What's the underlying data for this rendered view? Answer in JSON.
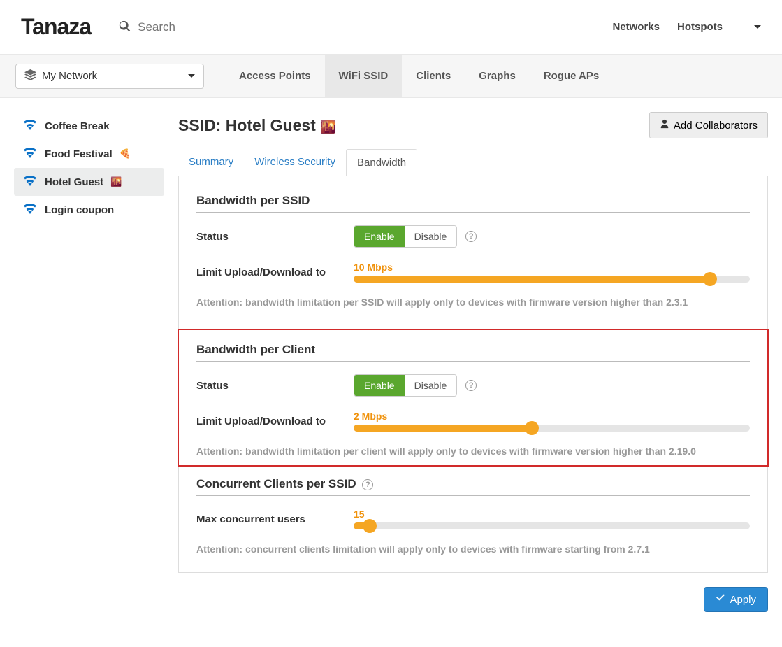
{
  "header": {
    "logo": "Tanaza",
    "search_placeholder": "Search",
    "nav": {
      "networks": "Networks",
      "hotspots": "Hotspots"
    }
  },
  "subnav": {
    "network_selected": "My Network",
    "tabs": {
      "access_points": "Access Points",
      "wifi_ssid": "WiFi SSID",
      "clients": "Clients",
      "graphs": "Graphs",
      "rogue_aps": "Rogue APs"
    }
  },
  "sidebar": {
    "items": [
      {
        "label": "Coffee Break",
        "emoji": ""
      },
      {
        "label": "Food Festival",
        "emoji": "🍕"
      },
      {
        "label": "Hotel Guest",
        "emoji": "🌇"
      },
      {
        "label": "Login coupon",
        "emoji": ""
      }
    ]
  },
  "content": {
    "title_prefix": "SSID: ",
    "title_name": "Hotel Guest",
    "title_emoji": "🌇",
    "collab_button": "Add Collaborators",
    "inner_tabs": {
      "summary": "Summary",
      "wireless_security": "Wireless Security",
      "bandwidth": "Bandwidth"
    },
    "sections": {
      "bw_ssid": {
        "title": "Bandwidth per SSID",
        "status_label": "Status",
        "enable": "Enable",
        "disable": "Disable",
        "limit_label": "Limit Upload/Download to",
        "limit_value": "10 Mbps",
        "slider_percent": 90,
        "attention": "Attention: bandwidth limitation per SSID will apply only to devices with firmware version higher than 2.3.1"
      },
      "bw_client": {
        "title": "Bandwidth per Client",
        "status_label": "Status",
        "enable": "Enable",
        "disable": "Disable",
        "limit_label": "Limit Upload/Download to",
        "limit_value": "2 Mbps",
        "slider_percent": 45,
        "attention": "Attention: bandwidth limitation per client will apply only to devices with firmware version higher than 2.19.0"
      },
      "concurrent": {
        "title": "Concurrent Clients per SSID",
        "max_label": "Max concurrent users",
        "max_value": "15",
        "slider_percent": 4,
        "attention": "Attention: concurrent clients limitation will apply only to devices with firmware starting from 2.7.1"
      }
    },
    "apply_button": "Apply"
  }
}
